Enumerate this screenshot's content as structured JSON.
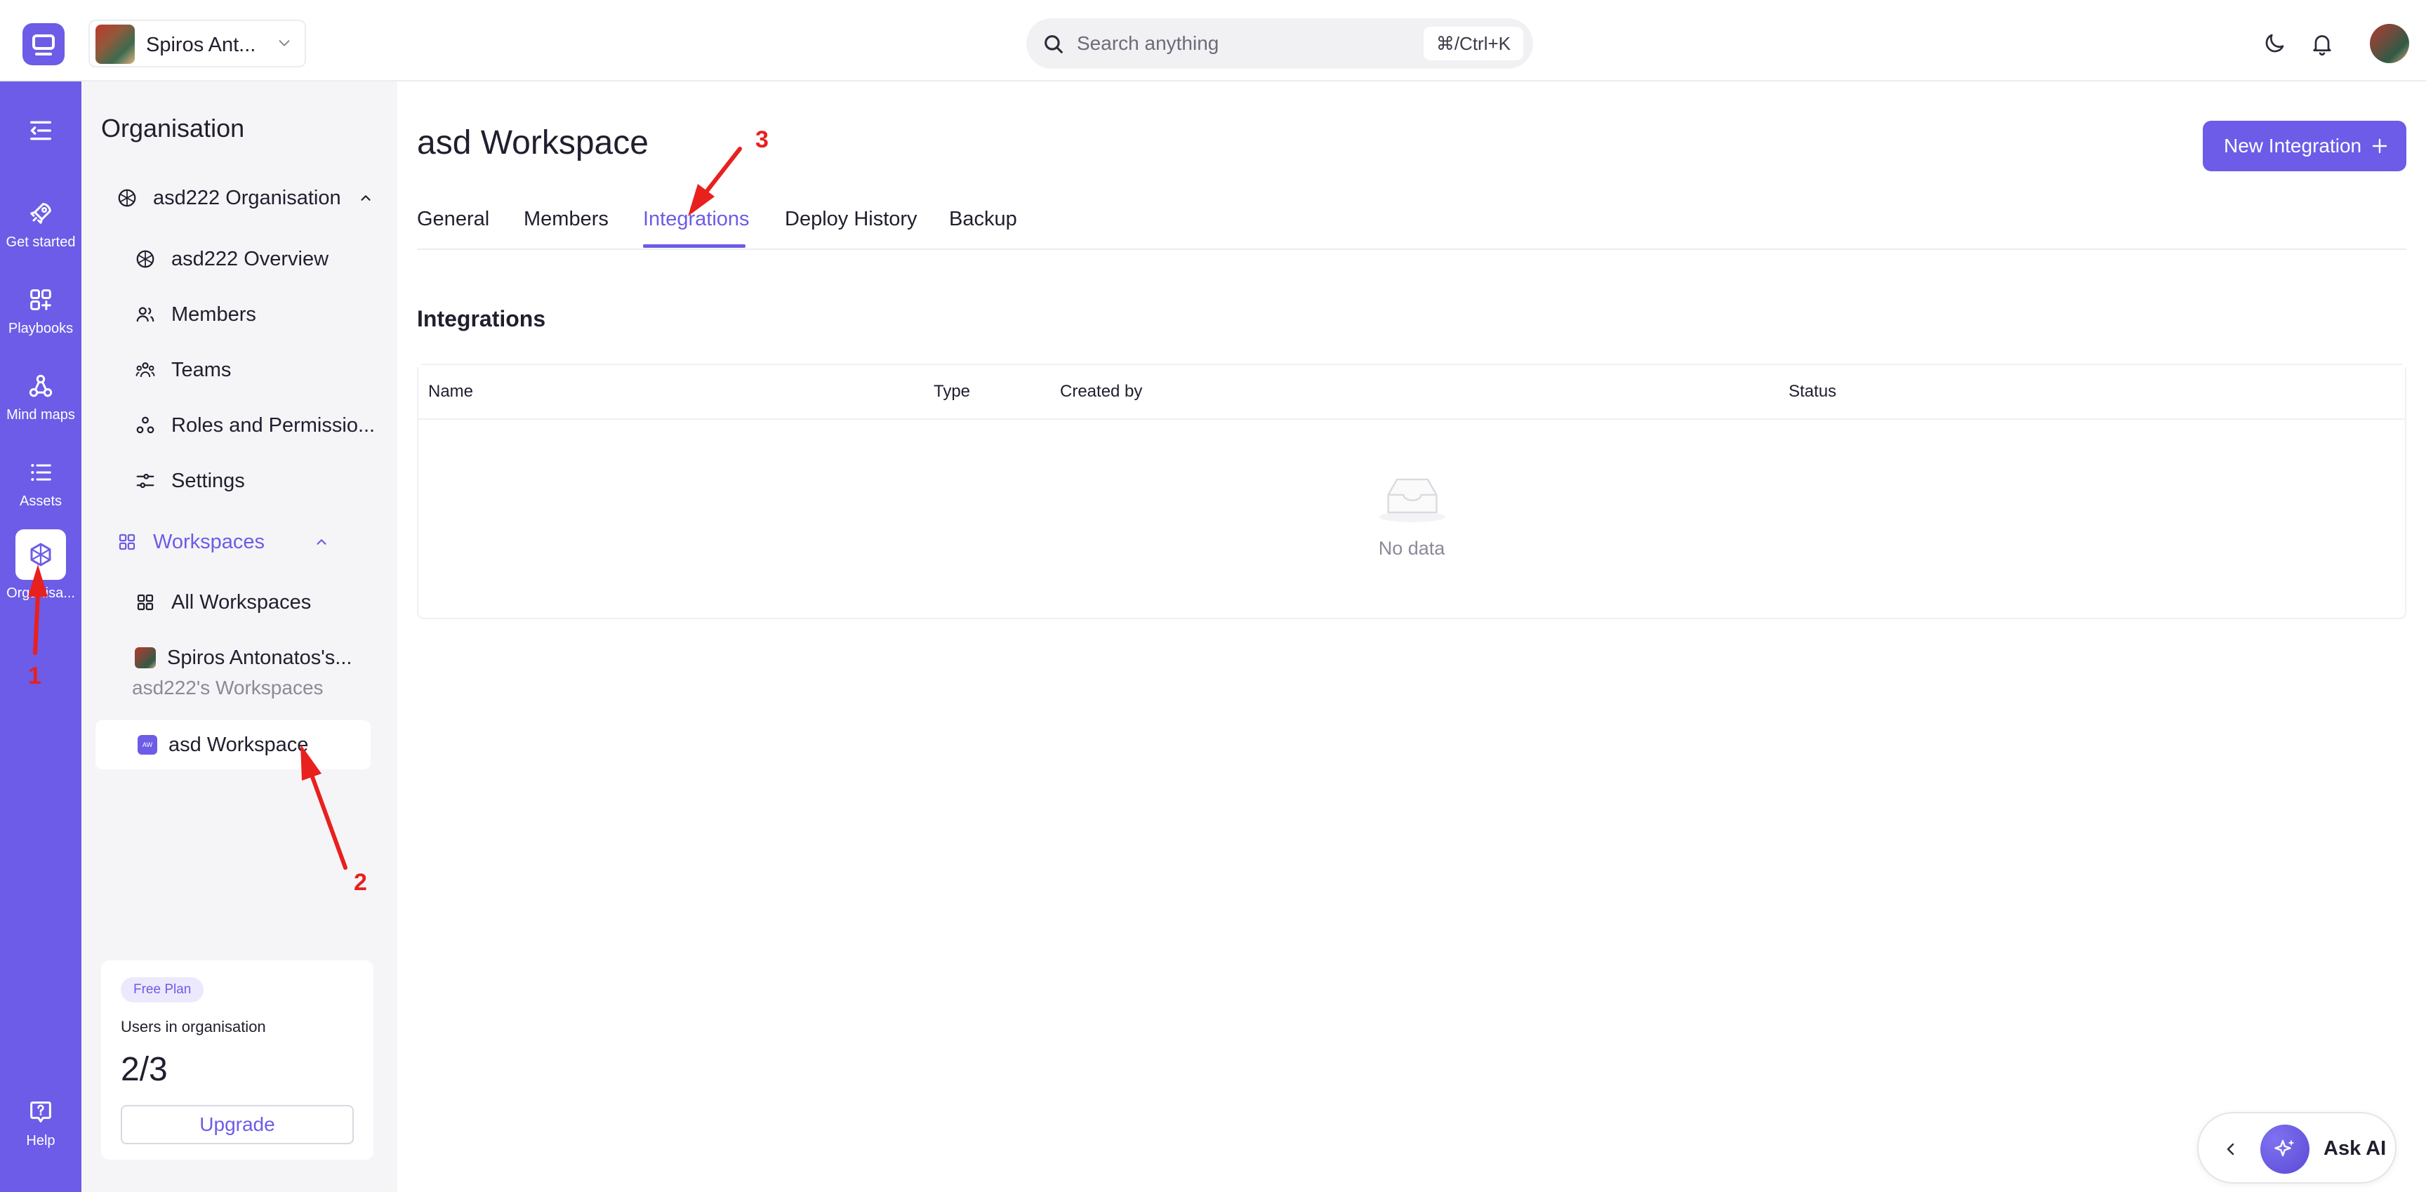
{
  "topbar": {
    "org_switch_name": "Spiros Ant...",
    "search_placeholder": "Search anything",
    "search_shortcut": "⌘/Ctrl+K"
  },
  "rail": {
    "items": [
      {
        "label": "Get started",
        "icon": "rocket-icon"
      },
      {
        "label": "Playbooks",
        "icon": "grid-plus-icon"
      },
      {
        "label": "Mind maps",
        "icon": "nodes-icon"
      },
      {
        "label": "Assets",
        "icon": "list-icon"
      },
      {
        "label": "Organisa...",
        "icon": "organisation-icon"
      },
      {
        "label": "Help",
        "icon": "help-icon"
      }
    ]
  },
  "sidenav": {
    "title": "Organisation",
    "org_group": "asd222 Organisation",
    "org_items": [
      "asd222 Overview",
      "Members",
      "Teams",
      "Roles and Permissio...",
      "Settings"
    ],
    "workspaces_label": "Workspaces",
    "workspace_items": [
      "All Workspaces",
      "Spiros Antonatos's..."
    ],
    "group_label": "asd222's Workspaces",
    "selected_workspace": "asd Workspace",
    "selected_workspace_chip": "AW"
  },
  "plan": {
    "badge": "Free Plan",
    "users_label": "Users in organisation",
    "count": "2/3",
    "upgrade": "Upgrade"
  },
  "main": {
    "title": "asd Workspace",
    "new_button": "New Integration",
    "tabs": [
      "General",
      "Members",
      "Integrations",
      "Deploy History",
      "Backup"
    ],
    "active_tab": "Integrations",
    "section_title": "Integrations",
    "columns": [
      "Name",
      "Type",
      "Created by",
      "Status"
    ],
    "empty_text": "No data"
  },
  "askai": {
    "label": "Ask AI"
  },
  "annotations": [
    "1",
    "2",
    "3"
  ],
  "colors": {
    "accent": "#6c5ce7",
    "annotation": "#e8201e"
  }
}
